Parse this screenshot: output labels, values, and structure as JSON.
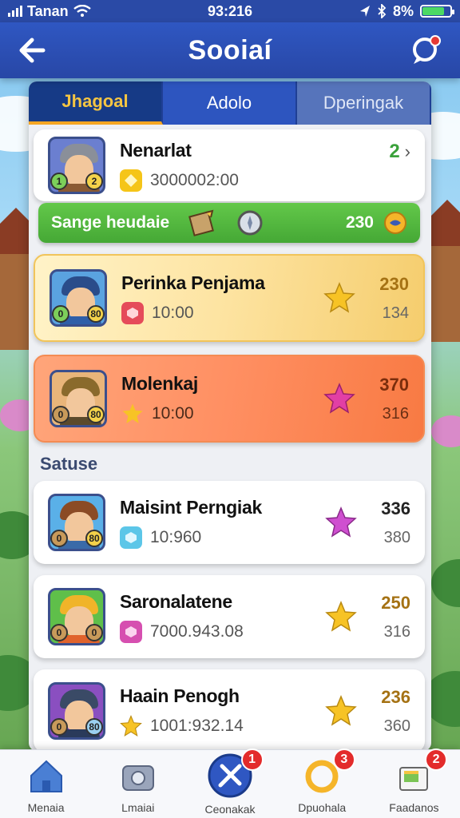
{
  "status_bar": {
    "carrier": "Tanan",
    "time": "93:216",
    "battery": "8%",
    "battery_level": 0.8
  },
  "header": {
    "title": "Sooiaí"
  },
  "tabs": [
    {
      "label": "Jhagoal",
      "active": true
    },
    {
      "label": "Adolo",
      "active": false
    },
    {
      "label": "Dperingak",
      "active": false
    }
  ],
  "featured": {
    "name": "Nenarlat",
    "value": "3000002:00",
    "count": "2",
    "badges": [
      "1",
      "2"
    ]
  },
  "green_bar": {
    "label": "Sange heudaie",
    "value": "230"
  },
  "highlight_cards": [
    {
      "name": "Perinka Penjama",
      "value": "10:00",
      "score": "230",
      "score2": "134",
      "badges": [
        "0",
        "80"
      ]
    },
    {
      "name": "Molenkaj",
      "value": "10:00",
      "score": "370",
      "score2": "316",
      "badges": [
        "0",
        "80"
      ]
    }
  ],
  "section_label": "Satuse",
  "list": [
    {
      "name": "Maisint Perngiak",
      "value": "10:960",
      "score": "336",
      "score2": "380",
      "badges": [
        "0",
        "80"
      ]
    },
    {
      "name": "Saronalatene",
      "value": "7000.943.08",
      "score": "250",
      "score2": "316",
      "badges": [
        "0",
        "0"
      ]
    },
    {
      "name": "Haain Penogh",
      "value": "1001:932.14",
      "score": "236",
      "score2": "360",
      "badges": [
        "0",
        "80"
      ]
    }
  ],
  "bottom_nav": [
    {
      "label": "Menaia",
      "icon": "home-icon",
      "badge": ""
    },
    {
      "label": "Lmaiai",
      "icon": "camera-icon",
      "badge": ""
    },
    {
      "label": "Ceonakak",
      "icon": "swords-icon",
      "badge": "1"
    },
    {
      "label": "Dpuohala",
      "icon": "ring-icon",
      "badge": "3"
    },
    {
      "label": "Faadanos",
      "icon": "box-icon",
      "badge": "2"
    }
  ],
  "colors": {
    "header": "#2f57c2",
    "green": "#4fb53c",
    "gold": "#f5cd6d",
    "orange": "#f87a43",
    "badge": "#e32b2b"
  }
}
